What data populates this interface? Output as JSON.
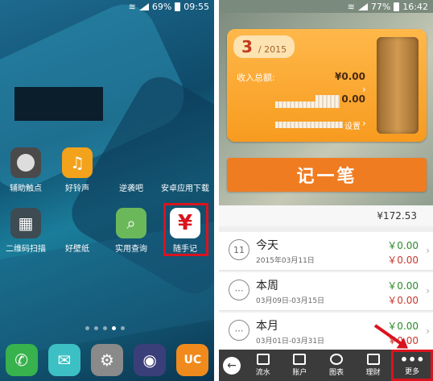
{
  "left_phone": {
    "status": {
      "battery": "69%",
      "time": "09:55"
    },
    "apps": [
      {
        "label": "辅助触点",
        "icon": "assistive-touch-icon",
        "color": "#4a4a4a"
      },
      {
        "label": "好铃声",
        "icon": "music-note-icon",
        "color": "#f3a21c"
      },
      {
        "label": "逆袭吧",
        "icon": "game-icon",
        "color": "#3d5a6a"
      },
      {
        "label": "安卓应用下载",
        "icon": "download-icon",
        "color": "#2f7fa0"
      },
      {
        "label": "二维码扫描",
        "icon": "qr-code-icon",
        "color": "#3e4b52"
      },
      {
        "label": "好壁纸",
        "icon": "wallpaper-icon",
        "color": "#2d6e8b"
      },
      {
        "label": "实用查询",
        "icon": "search-lens-icon",
        "color": "#6bb85a"
      },
      {
        "label": "随手记",
        "icon": "yuan-icon",
        "symbol": "¥",
        "color": "#ffffff"
      }
    ],
    "dock": [
      {
        "icon": "phone-icon",
        "glyph": "✆",
        "color": "#37b24d"
      },
      {
        "icon": "message-icon",
        "glyph": "💬",
        "color": "#3cc0c4"
      },
      {
        "icon": "settings-icon",
        "glyph": "⚙",
        "color": "#8a8a8a"
      },
      {
        "icon": "camera-icon",
        "glyph": "◉",
        "color": "#3a3f7a"
      },
      {
        "icon": "uc-browser-icon",
        "glyph": "UC",
        "color": "#f08a1c"
      }
    ]
  },
  "right_phone": {
    "status": {
      "battery": "77%",
      "time": "16:42"
    },
    "card": {
      "month": "3",
      "year": "/ 2015",
      "income_label": "收入总额:",
      "income_value": "¥0.00",
      "second_value": "0.00",
      "settings_label": "设置"
    },
    "record_button": "记一笔",
    "balance": "¥172.53",
    "periods": [
      {
        "title": "今天",
        "sub": "2015年03月11日",
        "income": "￥0.00",
        "expense": "￥0.00",
        "cal": "11"
      },
      {
        "title": "本周",
        "sub": "03月09日-03月15日",
        "income": "￥0.00",
        "expense": "￥0.00",
        "cal": "⋯"
      },
      {
        "title": "本月",
        "sub": "03月01日-03月31日",
        "income": "￥0.00",
        "expense": "￥0.00",
        "cal": "⋯"
      }
    ],
    "bottom_nav": {
      "flow": "流水",
      "account": "账户",
      "chart": "图表",
      "finance": "理财",
      "more": "更多"
    }
  }
}
